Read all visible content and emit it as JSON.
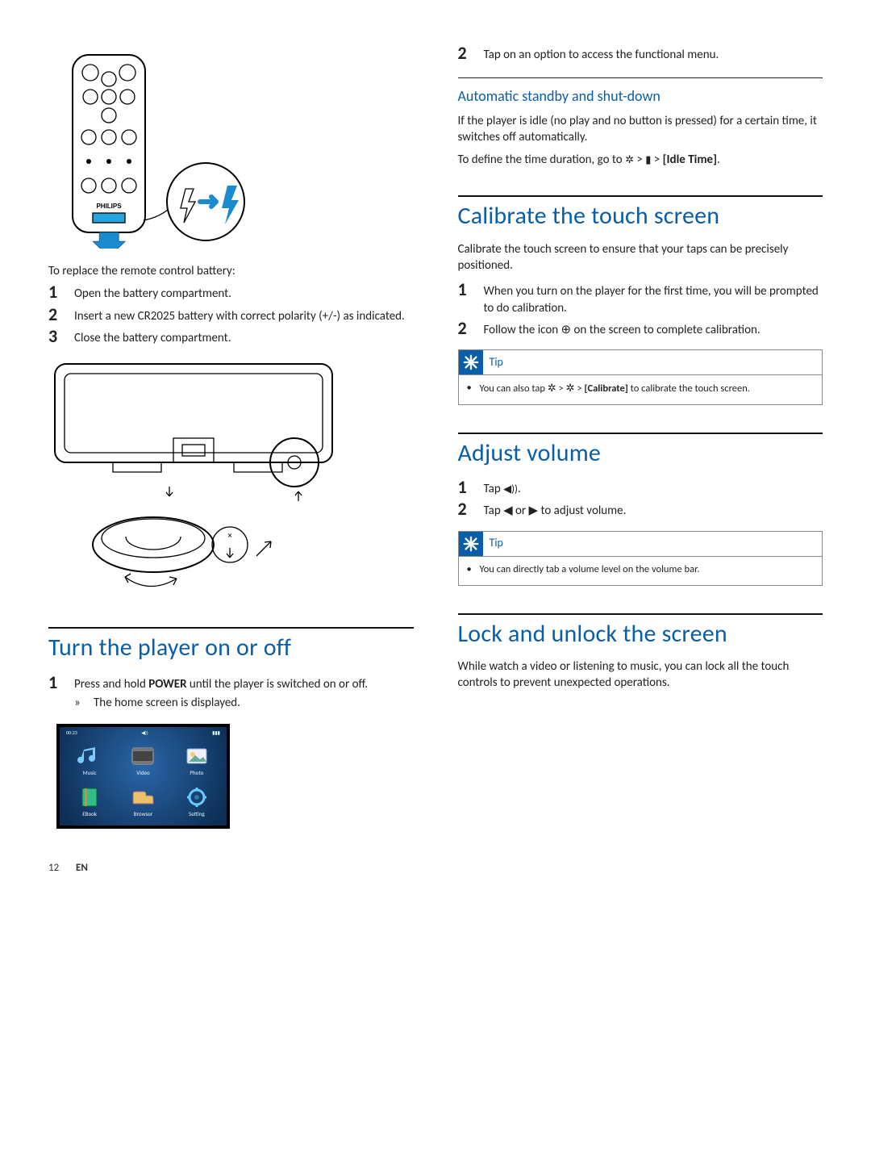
{
  "left": {
    "remote_leadin": "To replace the remote control battery:",
    "remote_steps": [
      "Open the battery compartment.",
      "Insert a new CR2025 battery with correct polarity (+/-) as indicated.",
      "Close the battery compartment."
    ],
    "turn_on_title": "Turn the player on or off",
    "turn_on_step_prefix": "Press and hold ",
    "turn_on_power_word": "POWER",
    "turn_on_step_suffix": " until the player is switched on or off.",
    "turn_on_result": "The home screen is displayed."
  },
  "home_icons": {
    "topbar_left": "00:23",
    "topbar_mid": "◀))",
    "topbar_right": "▮▮▮",
    "labels": [
      "Music",
      "Video",
      "Photo",
      "EBook",
      "Browser",
      "Setting"
    ]
  },
  "right": {
    "func_menu_step": "Tap on an option to access the functional menu.",
    "standby_title": "Automatic standby and shut-down",
    "standby_para": "If the player is idle (no play and no button is pressed) for a certain time, it switches off automatically.",
    "standby_define_prefix": "To define the time duration, go to ",
    "standby_define_bold": "[Idle Time]",
    "calibrate_title": "Calibrate the touch screen",
    "calibrate_para": "Calibrate the touch screen to ensure that your taps can be precisely positioned.",
    "calibrate_steps": [
      "When you turn on the player for the first time, you will be prompted to do calibration.",
      "Follow the icon ⊕ on the screen to complete calibration."
    ],
    "tip_label": "Tip",
    "calibrate_tip_prefix": "You can also tap ",
    "calibrate_tip_bold": "[Calibrate]",
    "calibrate_tip_suffix": " to calibrate the touch screen.",
    "volume_title": "Adjust volume",
    "volume_step1_prefix": "Tap ",
    "volume_step2": "Tap ◀ or ▶ to adjust volume.",
    "volume_tip": "You can directly tab a volume level on the volume bar.",
    "lock_title": "Lock and unlock the screen",
    "lock_para": "While watch a video or listening to music, you can lock all the touch controls to prevent unexpected operations."
  },
  "footer": {
    "page": "12",
    "lang": "EN"
  }
}
